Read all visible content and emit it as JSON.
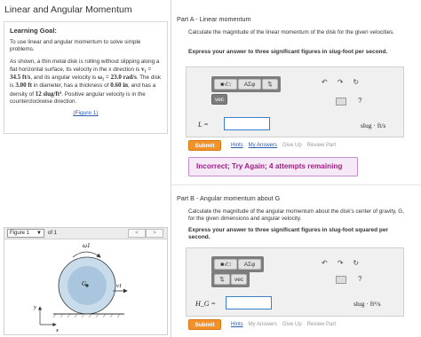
{
  "left_panel": {
    "title": "Linear and Angular Momentum",
    "goal_title": "Learning Goal:",
    "goal_text": "To use linear and angular momentum to solve simple problems.",
    "desc_parts": [
      "As shown, a thin metal disk is rolling without slipping along a flat horizontal surface, its velocity in the x direction is ",
      "v₁ = 34.5 ft/s",
      ", and its angular velocity is ",
      "ω₁ = 23.0 rad/s",
      ". The disk is ",
      "3.00 ft",
      " in diameter, has a thickness of ",
      "0.60 in",
      ", and has a density of ",
      "12 slug/ft³",
      ". Positive angular velocity is in the counterclockwise direction."
    ],
    "figure_link": "(Figure 1)",
    "figure_select": "Figure 1",
    "figure_of": "of 1",
    "prev_arrow": "<",
    "next_arrow": ">",
    "figure_labels": {
      "omega": "ω1",
      "center": "G",
      "velocity": "v1",
      "y_axis": "y",
      "x_axis": "x"
    }
  },
  "part_a": {
    "title": "Part A - Linear momentum",
    "description": "Calculate the magnitude of the linear momentum of the disk for the given velocities.",
    "instructions": "Express your answer to three significant figures in slug-foot per second.",
    "toolbar": {
      "templates": "■√□",
      "greek": "AΣφ",
      "arrows": "⇅",
      "vec": "vec"
    },
    "controls": {
      "undo": "↶",
      "redo": "↷",
      "reset": "↻",
      "help": "?"
    },
    "label": "L =",
    "answer_value": "",
    "unit": "slug · ft/s",
    "submit": "Submit",
    "links": [
      "Hints",
      "My Answers",
      "Give Up",
      "Review Part"
    ],
    "feedback": "Incorrect; Try Again; 4 attempts remaining"
  },
  "part_b": {
    "title": "Part B - Angular momentum about G",
    "description": "Calculate the magnitude of the angular momentum about the disk's center of gravity, G, for the given dimensions and angular velocity.",
    "instructions": "Express your answer to three significant figures in slug-foot squared per second.",
    "toolbar": {
      "templates": "■√□",
      "greek": "AΣφ",
      "arrows": "⇅",
      "vec": "vec"
    },
    "controls": {
      "undo": "↶",
      "redo": "↷",
      "reset": "↻",
      "help": "?"
    },
    "label": "H_G =",
    "answer_value": "",
    "unit": "slug · ft²/s",
    "submit": "Submit",
    "links": [
      "Hints",
      "My Answers",
      "Give Up",
      "Review Part"
    ]
  },
  "colors": {
    "accent_submit": "#f4922a",
    "link": "#2a5db0",
    "feedback_text": "#a11c86",
    "feedback_bg": "#f6e9f7",
    "disk_fill": "#c8dcec",
    "input_border": "#3d7ec9"
  }
}
